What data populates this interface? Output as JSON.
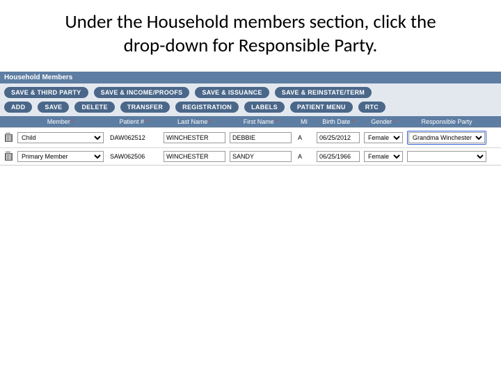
{
  "instruction": "Under the Household members section, click the drop-down for Responsible Party.",
  "section_title": "Household Members",
  "toolbar_row1": [
    "SAVE & THIRD PARTY",
    "SAVE & INCOME/PROOFS",
    "SAVE & ISSUANCE",
    "SAVE & REINSTATE/TERM"
  ],
  "toolbar_row2": [
    "ADD",
    "SAVE",
    "DELETE",
    "TRANSFER",
    "REGISTRATION",
    "LABELS",
    "PATIENT MENU",
    "RTC"
  ],
  "columns": {
    "member": "Member",
    "patient": "Patient #",
    "lname": "Last Name",
    "fname": "First Name",
    "mi": "MI",
    "bdate": "Birth Date",
    "gender": "Gender",
    "resp": "Responsible Party"
  },
  "rows": [
    {
      "member": "Child",
      "patient": "DAW062512",
      "lname": "WINCHESTER",
      "fname": "DEBBIE",
      "mi": "A",
      "bdate": "06/25/2012",
      "gender": "Female",
      "resp": "Grandma Winchester",
      "resp_highlight": true
    },
    {
      "member": "Primary Member",
      "patient": "SAW062506",
      "lname": "WINCHESTER",
      "fname": "SANDY",
      "mi": "A",
      "bdate": "06/25/1966",
      "gender": "Female",
      "resp": "",
      "resp_highlight": false
    }
  ]
}
